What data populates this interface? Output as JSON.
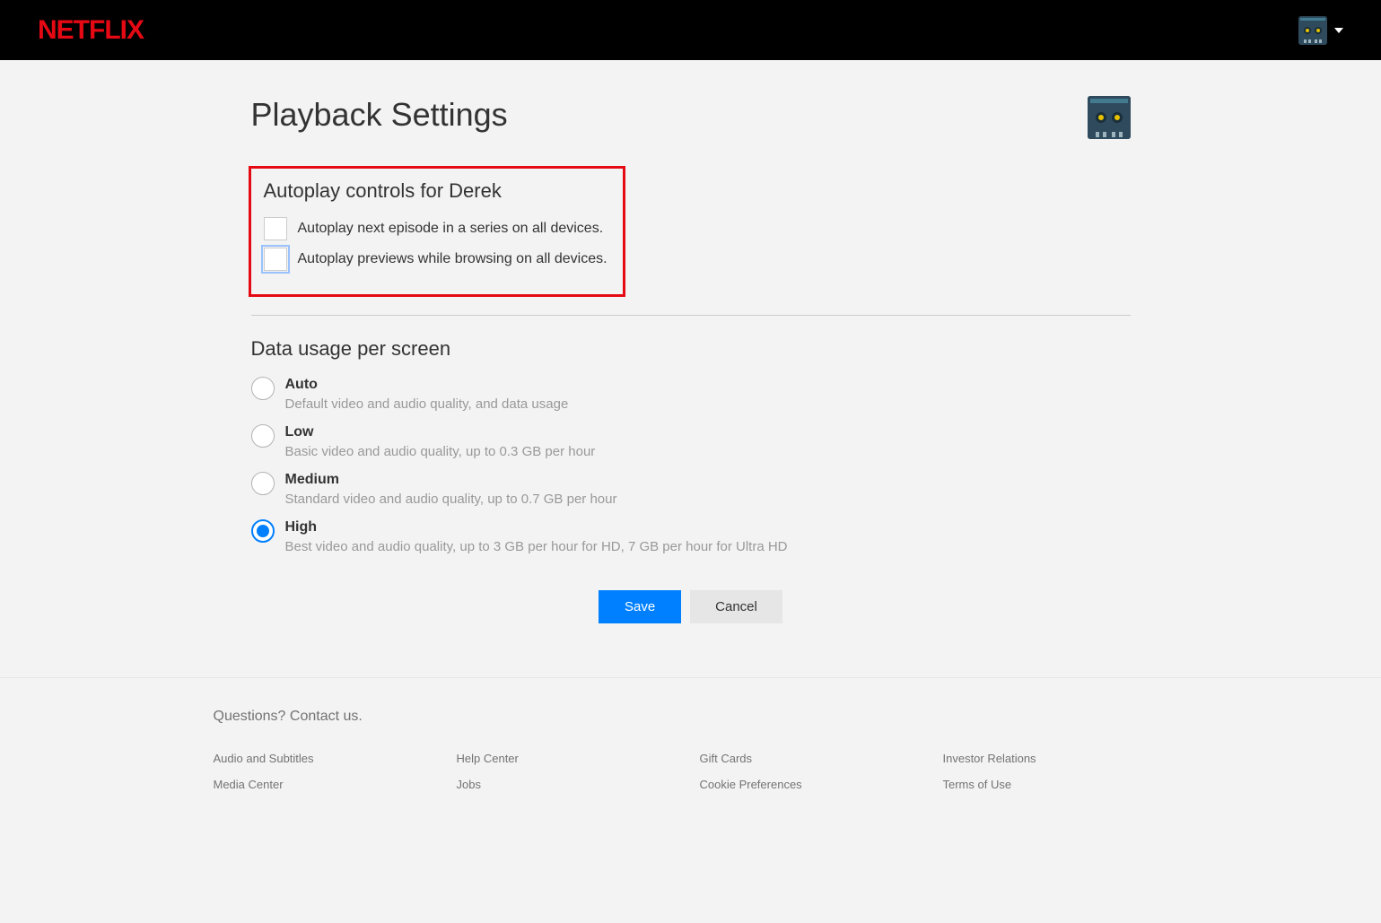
{
  "brand": "NETFLIX",
  "page_title": "Playback Settings",
  "autoplay": {
    "section_title": "Autoplay controls for Derek",
    "next_episode": {
      "label": "Autoplay next episode in a series on all devices.",
      "checked": false
    },
    "previews": {
      "label": "Autoplay previews while browsing on all devices.",
      "checked": false,
      "focused": true
    }
  },
  "data_usage": {
    "section_title": "Data usage per screen",
    "selected": "high",
    "options": [
      {
        "id": "auto",
        "label": "Auto",
        "desc": "Default video and audio quality, and data usage"
      },
      {
        "id": "low",
        "label": "Low",
        "desc": "Basic video and audio quality, up to 0.3 GB per hour"
      },
      {
        "id": "medium",
        "label": "Medium",
        "desc": "Standard video and audio quality, up to 0.7 GB per hour"
      },
      {
        "id": "high",
        "label": "High",
        "desc": "Best video and audio quality, up to 3 GB per hour for HD, 7 GB per hour for Ultra HD"
      }
    ]
  },
  "buttons": {
    "save": "Save",
    "cancel": "Cancel"
  },
  "footer": {
    "questions": "Questions? ",
    "contact": "Contact us.",
    "links": [
      "Audio and Subtitles",
      "Help Center",
      "Gift Cards",
      "Investor Relations",
      "Media Center",
      "Jobs",
      "Cookie Preferences",
      "Terms of Use"
    ]
  }
}
